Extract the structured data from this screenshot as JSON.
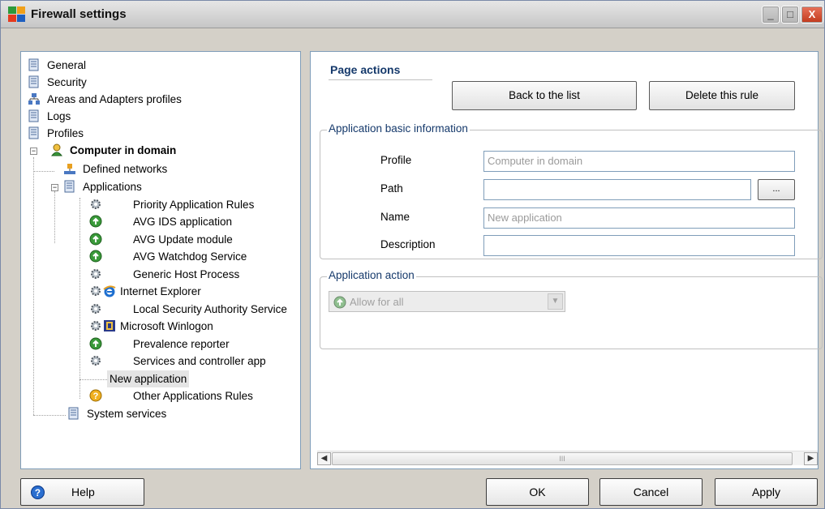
{
  "window": {
    "title": "Firewall settings",
    "controls": {
      "minimize": "_",
      "maximize": "□",
      "close": "X"
    }
  },
  "tree": {
    "items": [
      {
        "label": "General",
        "icon": "document-icon"
      },
      {
        "label": "Security",
        "icon": "document-icon"
      },
      {
        "label": "Areas and Adapters profiles",
        "icon": "network-icon"
      },
      {
        "label": "Logs",
        "icon": "document-icon"
      },
      {
        "label": "Profiles",
        "icon": "document-icon"
      },
      {
        "label": "Computer in domain",
        "icon": "user-icon"
      },
      {
        "label": "Defined networks",
        "icon": "network-icon"
      },
      {
        "label": "Applications",
        "icon": "document-icon"
      },
      {
        "label": "Priority Application Rules",
        "icon": "gear-icon"
      },
      {
        "label": "AVG IDS application",
        "icon": "allow-icon"
      },
      {
        "label": "AVG Update module",
        "icon": "allow-icon"
      },
      {
        "label": "AVG Watchdog Service",
        "icon": "allow-icon"
      },
      {
        "label": "Generic Host Process",
        "icon": "gear-icon"
      },
      {
        "label": "Internet Explorer",
        "icon": "ie-icon"
      },
      {
        "label": "Local Security Authority Service",
        "icon": "gear-icon"
      },
      {
        "label": "Microsoft Winlogon",
        "icon": "winlogon-icon"
      },
      {
        "label": "Prevalence reporter",
        "icon": "allow-icon"
      },
      {
        "label": "Services and controller app",
        "icon": "gear-icon"
      },
      {
        "label": "New application",
        "icon": ""
      },
      {
        "label": "Other Applications Rules",
        "icon": "question-icon"
      },
      {
        "label": "System services",
        "icon": "document-icon"
      }
    ],
    "selected": "New application"
  },
  "page_actions": {
    "title": "Page actions",
    "back_button": "Back to the list",
    "delete_button": "Delete this rule"
  },
  "basic_info": {
    "title": "Application basic information",
    "profile_label": "Profile",
    "profile_value": "Computer in domain",
    "path_label": "Path",
    "path_value": "",
    "browse_button": "...",
    "name_label": "Name",
    "name_value": "New application",
    "description_label": "Description",
    "description_value": ""
  },
  "app_action": {
    "title": "Application action",
    "selected": "Allow for all"
  },
  "scrollbar": {
    "grip": "III"
  },
  "footer": {
    "help": "Help",
    "ok": "OK",
    "cancel": "Cancel",
    "apply": "Apply"
  },
  "colors": {
    "section_title": "#15396b",
    "panel_border": "#7f9db9",
    "dialog_bg": "#d4d0c8"
  }
}
